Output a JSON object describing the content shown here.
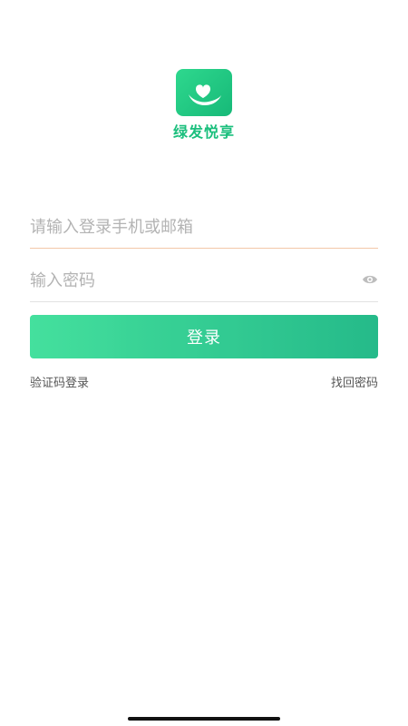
{
  "app": {
    "name": "绿发悦享",
    "logo_icon": "heart-hand-icon",
    "brand_color": "#1bbf7d"
  },
  "form": {
    "account_placeholder": "请输入登录手机或邮箱",
    "account_value": "",
    "password_placeholder": "输入密码",
    "password_value": "",
    "password_toggle_icon": "eye-icon",
    "login_label": "登录"
  },
  "links": {
    "sms_login": "验证码登录",
    "forgot_password": "找回密码"
  }
}
